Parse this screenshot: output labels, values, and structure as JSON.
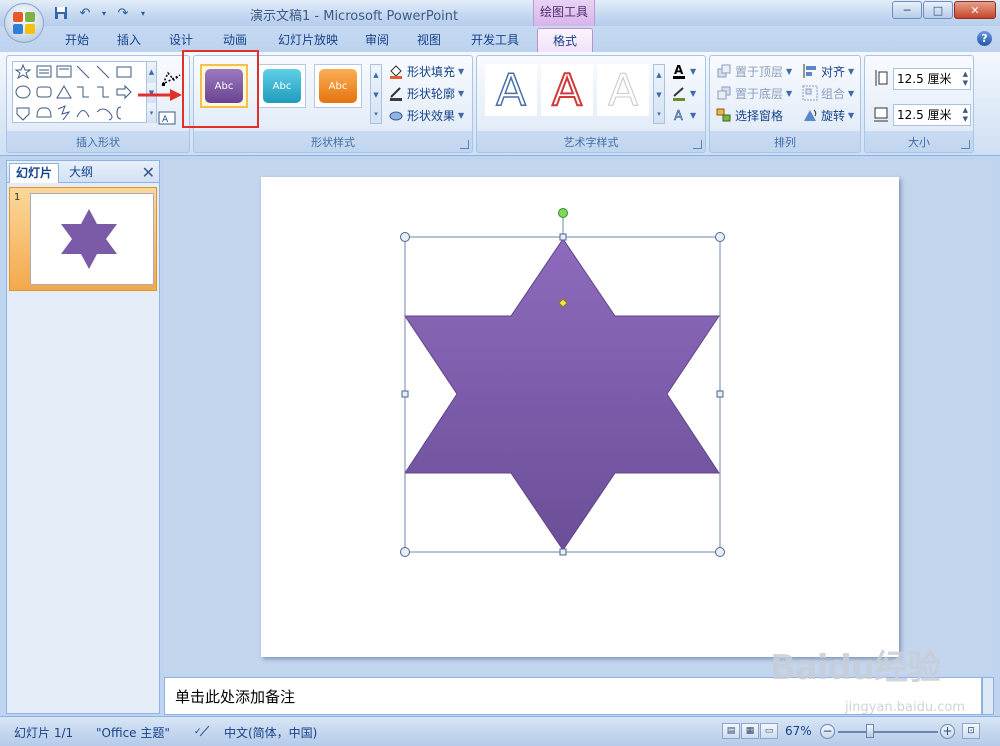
{
  "window": {
    "title": "演示文稿1 - Microsoft PowerPoint",
    "context_tab_group": "绘图工具",
    "minimize": "─",
    "maximize": "□",
    "close": "✕"
  },
  "tabs": [
    "开始",
    "插入",
    "设计",
    "动画",
    "幻灯片放映",
    "审阅",
    "视图",
    "开发工具",
    "格式"
  ],
  "active_tab": "格式",
  "help": "?",
  "ribbon": {
    "insert_shapes": {
      "label": "插入形状"
    },
    "shape_styles": {
      "label": "形状样式",
      "swatches": [
        {
          "text": "Abc",
          "color": "#7b519d"
        },
        {
          "text": "Abc",
          "color": "#31b6d3"
        },
        {
          "text": "Abc",
          "color": "#f58b1f"
        }
      ],
      "fill": "形状填充",
      "outline": "形状轮廓",
      "effects": "形状效果"
    },
    "wordart_styles": {
      "label": "艺术字样式",
      "glyph": "A"
    },
    "arrange": {
      "label": "排列",
      "bring_front": "置于顶层",
      "send_back": "置于底层",
      "selection_pane": "选择窗格",
      "align": "对齐",
      "group": "组合",
      "rotate": "旋转"
    },
    "size": {
      "label": "大小",
      "height": "12.5 厘米",
      "width": "12.5 厘米"
    }
  },
  "left_pane": {
    "tab_slides": "幻灯片",
    "tab_outline": "大纲",
    "close": "✕",
    "slide_number": "1"
  },
  "slide": {
    "shape_color": "#7b5ba8"
  },
  "notes": {
    "placeholder": "单击此处添加备注"
  },
  "status": {
    "slide_indicator": "幻灯片 1/1",
    "theme": "\"Office 主题\"",
    "language": "中文(简体，中国)",
    "zoom": "67%",
    "zoom_out": "−",
    "zoom_in": "+"
  },
  "watermark": {
    "text": "Baidu经验",
    "sub": "jingyan.baidu.com"
  }
}
